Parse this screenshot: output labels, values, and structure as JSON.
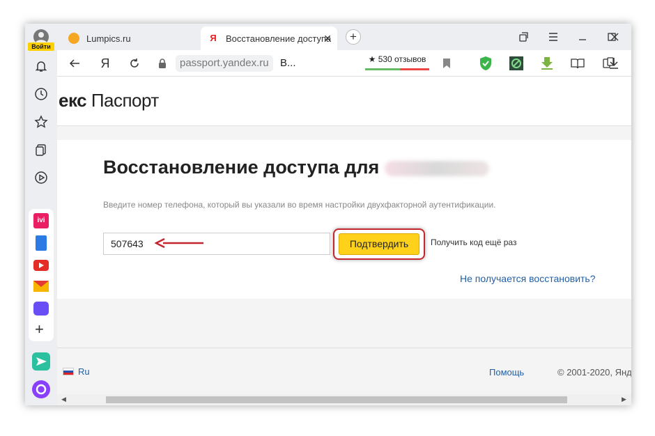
{
  "sidebar": {
    "login_label": "Войти"
  },
  "tabs": [
    {
      "title": "Lumpics.ru",
      "favicon": "lumpics-favicon-icon",
      "color": "#f5a623"
    },
    {
      "title": "Восстановление доступа",
      "favicon": "yandex-favicon-icon",
      "color": "#e21e1e"
    }
  ],
  "toolbar": {
    "yandex_letter": "Я",
    "url_domain": "passport.yandex.ru",
    "url_rest": "В...",
    "reviews": "★ 530 отзывов"
  },
  "page": {
    "logo_part": "екс",
    "logo_service": "Паспорт",
    "heading": "Восстановление доступа для",
    "hint": "Введите номер телефона, который вы указали во время настройки двухфакторной аутентификации.",
    "phone_value": "507643",
    "confirm_label": "Подтвердить",
    "resend_label": "Получить код ещё раз",
    "cant_restore_link": "Не получается восстановить?"
  },
  "footer": {
    "lang": "Ru",
    "help": "Помощь",
    "copyright": "© 2001-2020, Янд"
  },
  "colors": {
    "accent_yellow": "#ffd11a",
    "highlight_red": "#c3262e",
    "link_blue": "#2060a8"
  }
}
